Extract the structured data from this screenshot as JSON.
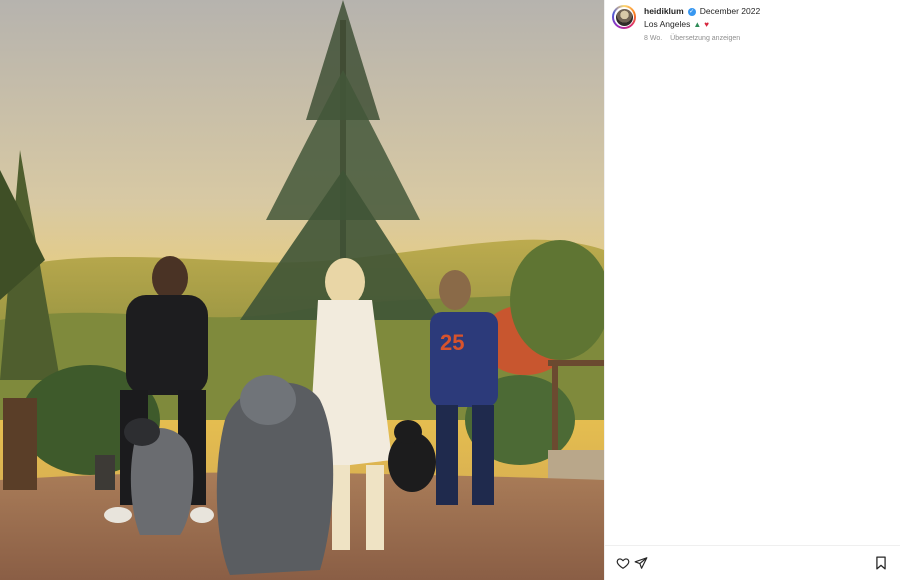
{
  "post": {
    "media": {
      "description_icon": "photo"
    },
    "author": {
      "username": "heidiklum",
      "verified_icon": "verified-badge-icon",
      "date": "December 2022"
    },
    "location": {
      "text": "Los Angeles",
      "emoji": [
        "christmas-tree",
        "red-heart"
      ]
    },
    "meta": {
      "age": "8 Wo.",
      "translate_label": "Übersetzung anzeigen"
    },
    "actions": {
      "like_icon": "heart-icon",
      "share_icon": "paper-plane-icon",
      "save_icon": "bookmark-icon"
    },
    "colors": {
      "verified": "#3897f0",
      "muted": "#8e8e8e",
      "text": "#262626"
    }
  }
}
